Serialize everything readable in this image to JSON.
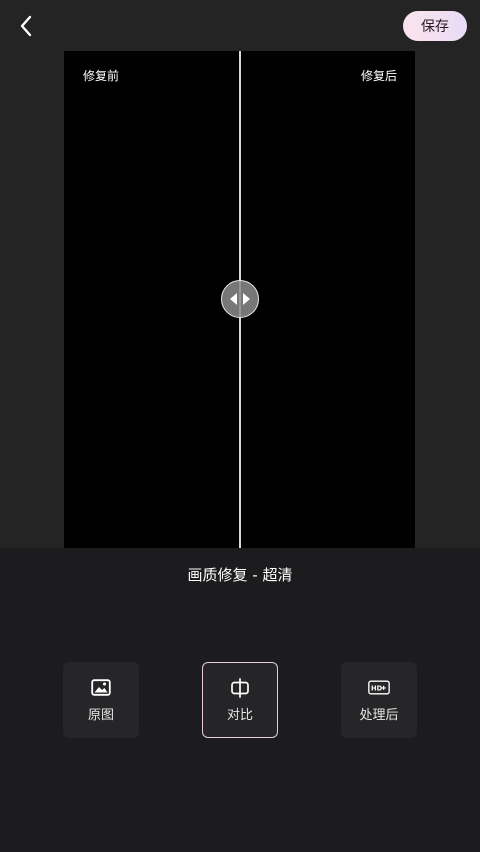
{
  "header": {
    "back_icon": "chevron-left-icon",
    "save_label": "保存"
  },
  "preview": {
    "before_label": "修复前",
    "after_label": "修复后",
    "handle_icon": "left-right-arrows-icon",
    "divider_position": 0.5
  },
  "panel": {
    "title": "画质修复 - 超清",
    "options": [
      {
        "label": "原图",
        "icon": "image-icon",
        "selected": false
      },
      {
        "label": "对比",
        "icon": "compare-icon",
        "selected": true
      },
      {
        "label": "处理后",
        "icon": "hd-plus-icon",
        "selected": false
      }
    ]
  },
  "colors": {
    "background": "#1c1c1e",
    "save_gradient_start": "#fbe3ec",
    "save_gradient_end": "#e9dcf7",
    "selected_border": "#e9c9dc"
  }
}
